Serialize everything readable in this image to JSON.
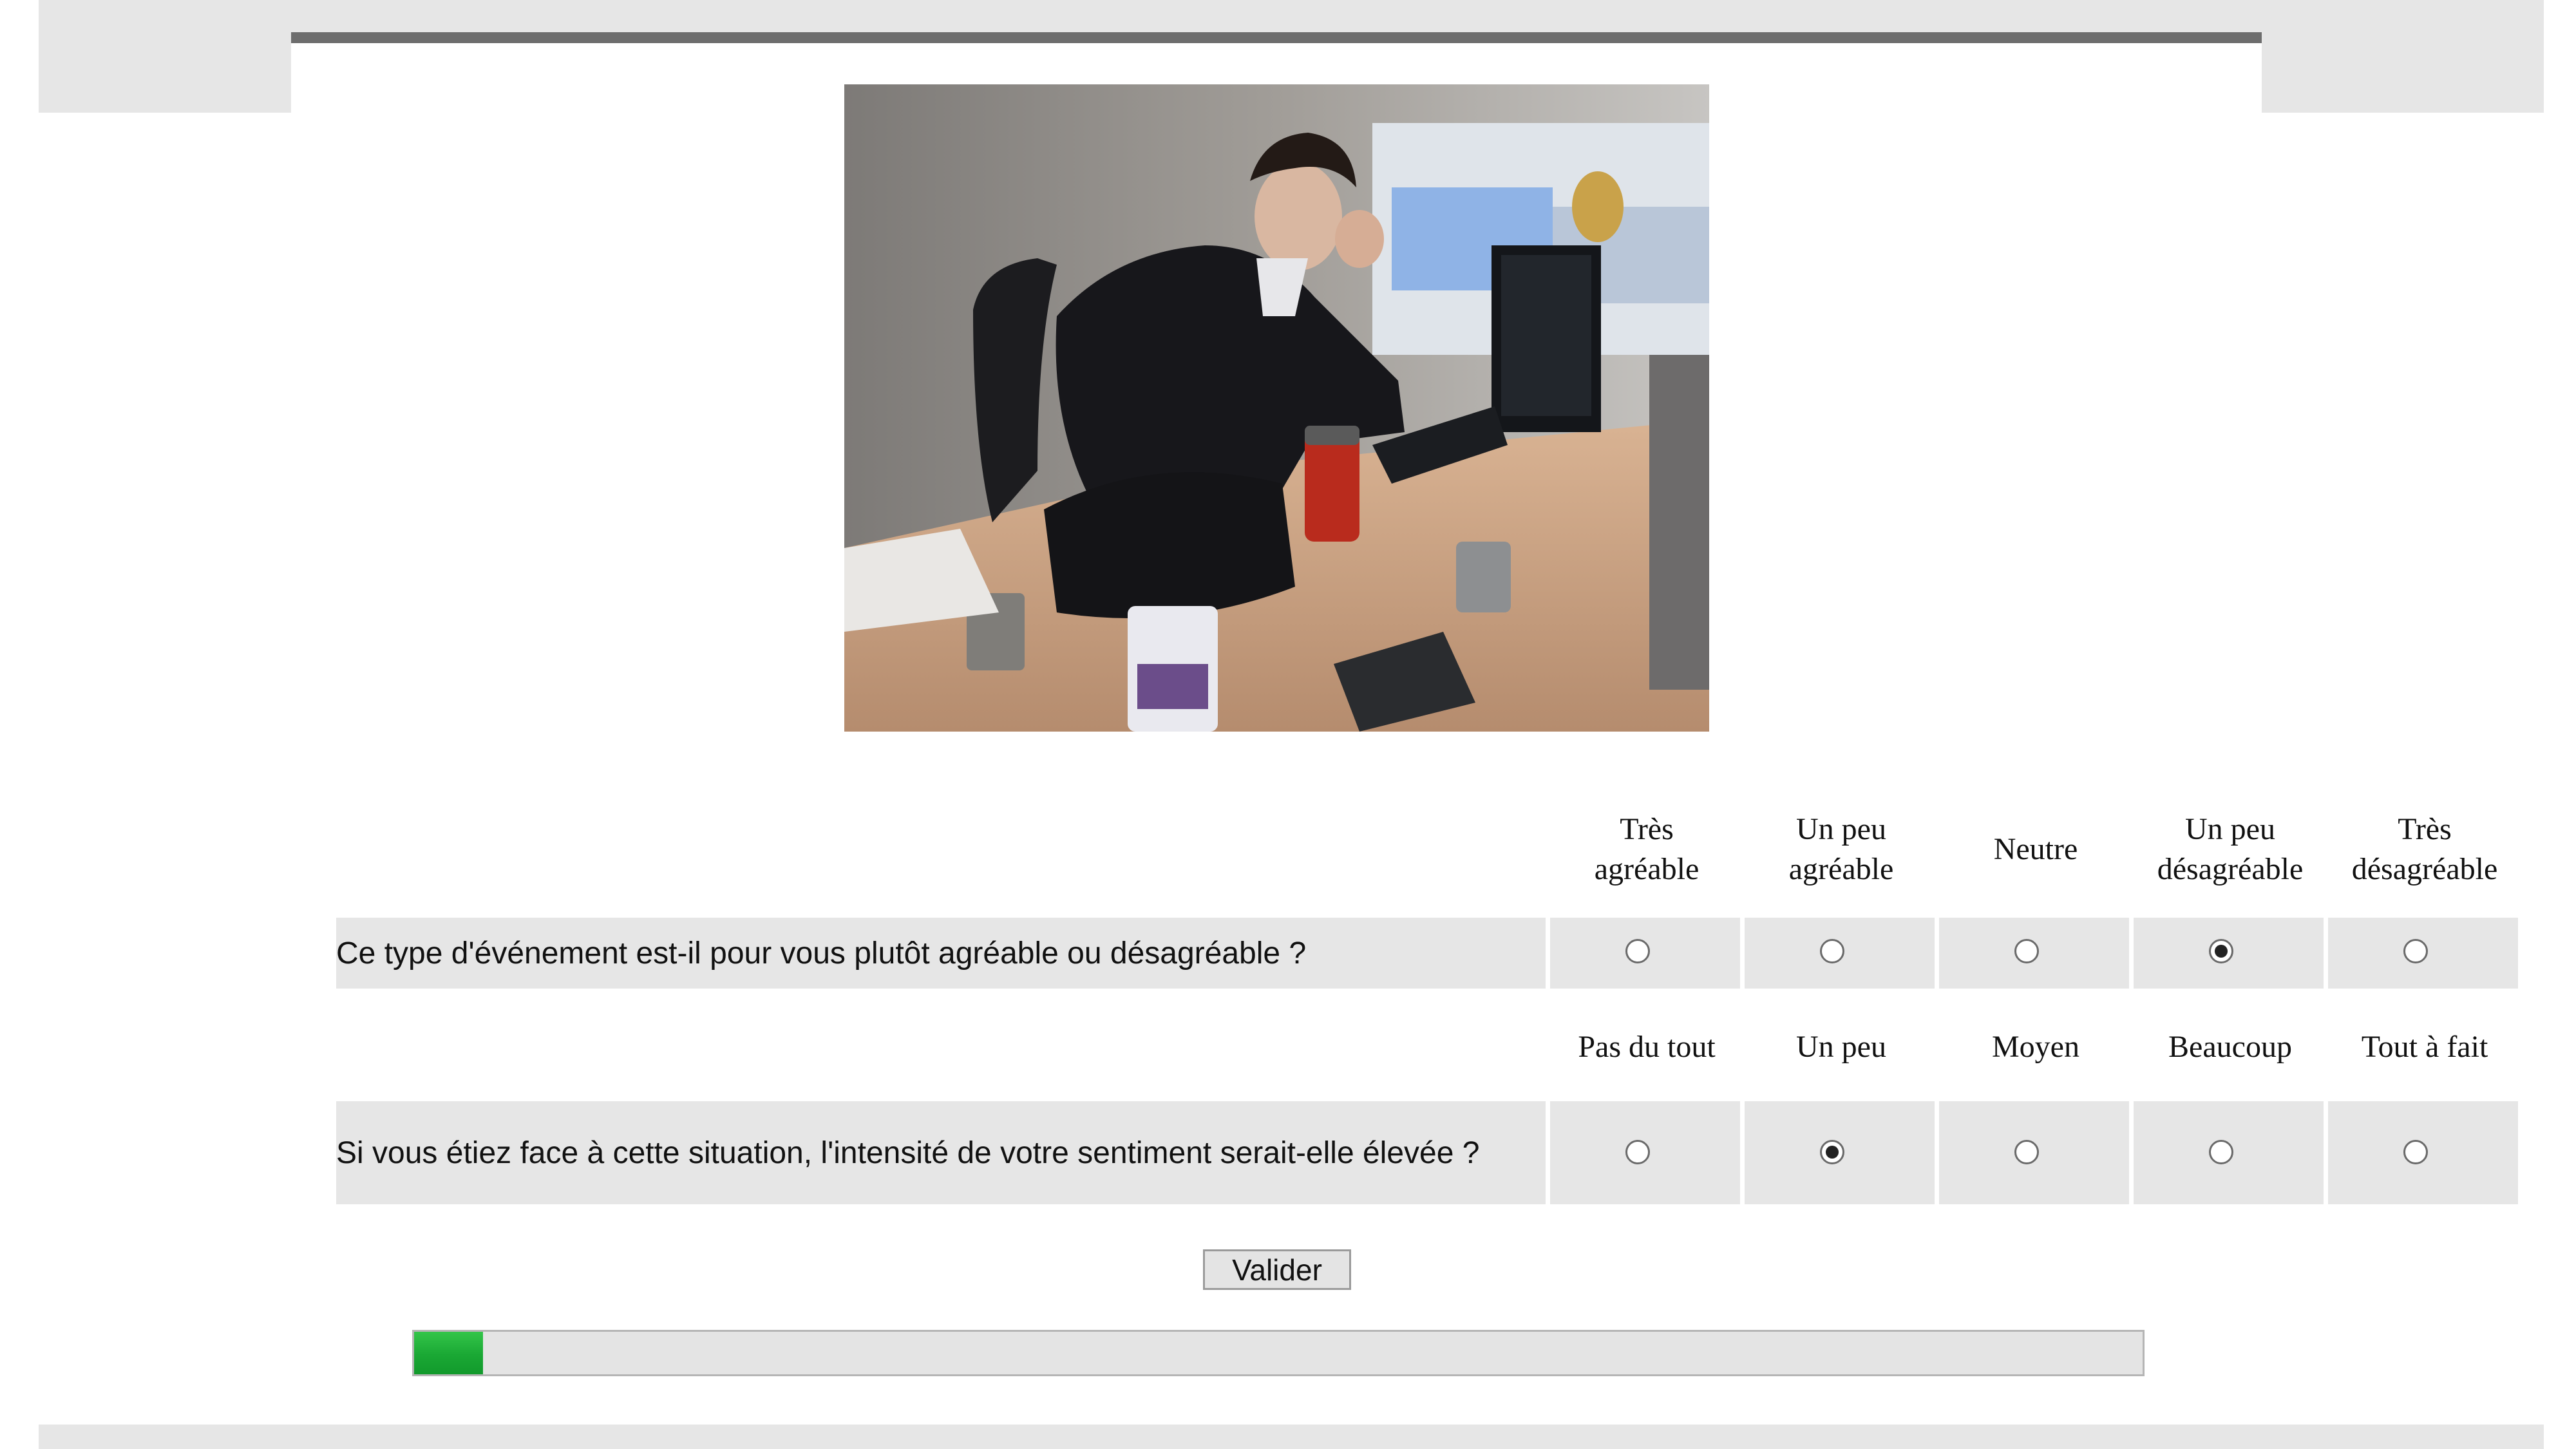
{
  "survey": {
    "question1": {
      "text": "Ce type d'événement est-il pour vous plutôt agréable ou désagréable ?",
      "options": [
        "Très\nagréable",
        "Un peu\nagréable",
        "Neutre",
        "Un peu\ndésagréable",
        "Très\ndésagréable"
      ],
      "selected_index": 3
    },
    "question2": {
      "text": "Si vous étiez face à cette situation, l'intensité de votre sentiment serait-elle élevée ?",
      "options": [
        "Pas du tout",
        "Un peu",
        "Moyen",
        "Beaucoup",
        "Tout à fait"
      ],
      "selected_index": 1
    },
    "submit_label": "Valider",
    "progress_fraction": 0.04
  },
  "colors": {
    "progress_green": "#1aa834",
    "row_background": "#e6e6e6",
    "header_rule": "#6d6d6d"
  }
}
